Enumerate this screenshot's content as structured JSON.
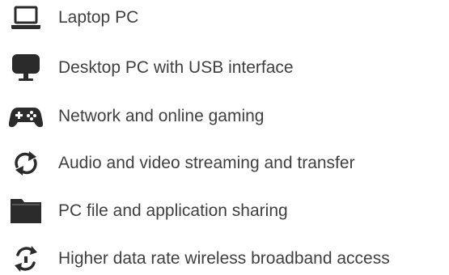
{
  "colors": {
    "icon": "#2b2b2b",
    "text": "#3f3f3f",
    "background": "#ffffff"
  },
  "features": [
    {
      "icon": "laptop-icon",
      "label": "Laptop PC"
    },
    {
      "icon": "desktop-monitor-icon",
      "label": "Desktop PC with USB interface"
    },
    {
      "icon": "gamepad-icon",
      "label": "Network and online gaming"
    },
    {
      "icon": "sync-arrows-icon",
      "label": "Audio and video streaming and transfer"
    },
    {
      "icon": "folder-icon",
      "label": "PC file and application sharing"
    },
    {
      "icon": "wireless-refresh-icon",
      "label": "Higher data rate wireless broadband access"
    }
  ]
}
